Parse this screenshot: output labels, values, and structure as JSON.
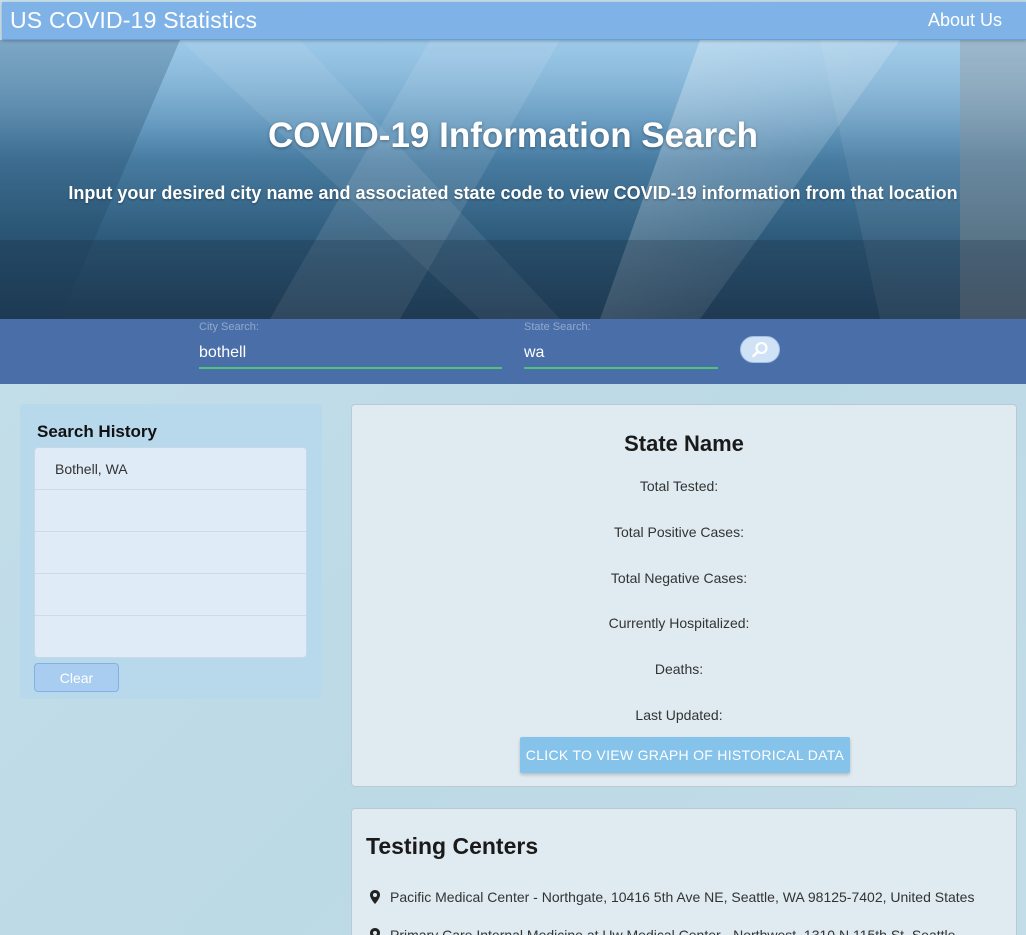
{
  "nav": {
    "brand": "US COVID-19 Statistics",
    "about": "About Us"
  },
  "hero": {
    "title": "COVID-19 Information Search",
    "subtitle": "Input your desired city name and associated state code to view COVID-19 information from that location"
  },
  "search": {
    "city_label": "City Search:",
    "city_value": "bothell",
    "state_label": "State Search:",
    "state_value": "wa",
    "button_icon": "search-icon"
  },
  "history": {
    "title": "Search History",
    "items": [
      "Bothell, WA",
      "",
      "",
      "",
      ""
    ],
    "clear_label": "Clear"
  },
  "state": {
    "title": "State Name",
    "stats": [
      "Total Tested:",
      "Total Positive Cases:",
      "Total Negative Cases:",
      "Currently Hospitalized:",
      "Deaths:",
      "Last Updated:"
    ],
    "graph_button": "CLICK TO VIEW GRAPH OF HISTORICAL DATA"
  },
  "centers": {
    "title": "Testing Centers",
    "items": [
      "Pacific Medical Center - Northgate, 10416 5th Ave NE, Seattle, WA 98125-7402, United States",
      "Primary Care Internal Medicine at Uw Medical Center - Northwest, 1310 N 115th St, Seattle"
    ]
  },
  "colors": {
    "navbar": "#7fb3e8",
    "search_bar": "#4a6ea8",
    "input_underline": "#4cc27a",
    "graph_button": "#86c3ea"
  }
}
